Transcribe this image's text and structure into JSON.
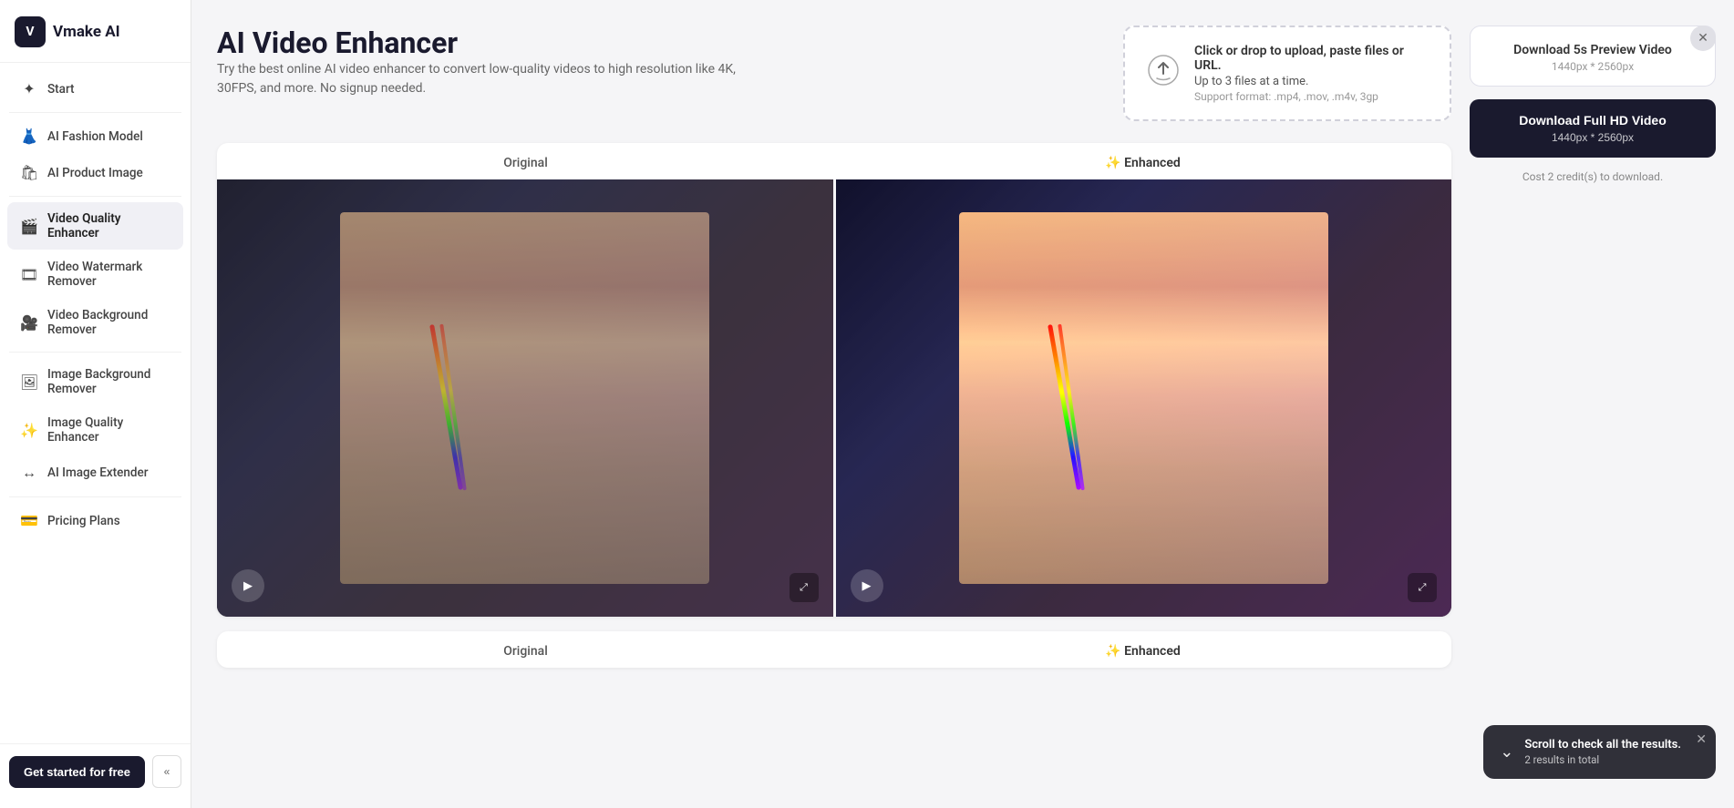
{
  "app": {
    "logo_icon": "V",
    "logo_text": "Vmake AI"
  },
  "sidebar": {
    "items": [
      {
        "id": "start",
        "label": "Start",
        "icon": "✦",
        "active": false
      },
      {
        "id": "fashion-model",
        "label": "AI Fashion Model",
        "icon": "👗",
        "active": false
      },
      {
        "id": "product-image",
        "label": "AI Product Image",
        "icon": "🛍",
        "active": false
      },
      {
        "id": "video-quality-enhancer",
        "label": "Video Quality Enhancer",
        "icon": "🎬",
        "active": true
      },
      {
        "id": "video-watermark-remover",
        "label": "Video Watermark Remover",
        "icon": "🎞",
        "active": false
      },
      {
        "id": "video-background-remover",
        "label": "Video Background Remover",
        "icon": "🎥",
        "active": false
      },
      {
        "id": "image-background-remover",
        "label": "Image Background Remover",
        "icon": "🖼",
        "active": false
      },
      {
        "id": "image-quality-enhancer",
        "label": "Image Quality Enhancer",
        "icon": "✨",
        "active": false
      },
      {
        "id": "ai-image-extender",
        "label": "AI Image Extender",
        "icon": "↔",
        "active": false
      },
      {
        "id": "pricing-plans",
        "label": "Pricing Plans",
        "icon": "💳",
        "active": false
      }
    ],
    "get_started_label": "Get started for free",
    "collapse_icon": "«"
  },
  "page": {
    "title": "AI Video Enhancer",
    "subtitle": "Try the best online AI video enhancer to convert low-quality videos to high resolution like 4K, 30FPS, and more. No signup needed."
  },
  "upload": {
    "main_text": "Click or drop to upload, paste files or URL.",
    "sub_text": "Up to 3 files at a time.",
    "format_text": "Support format: .mp4, .mov, .m4v, 3gp"
  },
  "comparison": {
    "rows": [
      {
        "original_label": "Original",
        "enhanced_label": "✨ Enhanced"
      },
      {
        "original_label": "Original",
        "enhanced_label": "✨ Enhanced"
      }
    ]
  },
  "right_panel": {
    "download_preview_title": "Download 5s Preview Video",
    "download_preview_size": "1440px * 2560px",
    "download_full_title": "Download Full HD Video",
    "download_full_size": "1440px * 2560px",
    "download_cost": "Cost 2 credit(s) to download."
  },
  "scroll_toast": {
    "title": "Scroll to check all the results.",
    "sub": "2 results in total"
  }
}
